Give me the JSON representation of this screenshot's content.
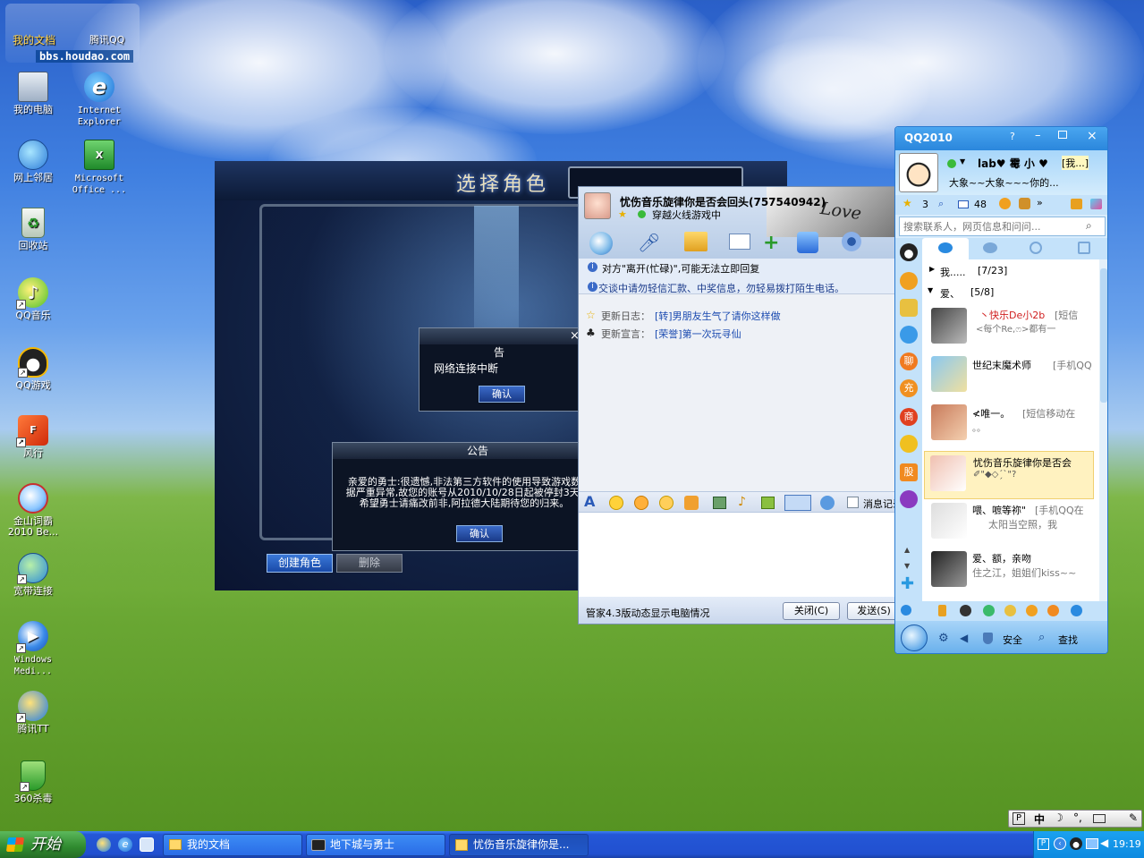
{
  "desktop": {
    "watermark": {
      "text1": "我的文档",
      "text2": "腾讯QQ",
      "url": "bbs.houdao.com"
    },
    "icons": [
      {
        "label": "我的电脑"
      },
      {
        "label": "Internet Explorer"
      },
      {
        "label": "网上邻居"
      },
      {
        "label": "Microsoft Office ..."
      },
      {
        "label": "回收站"
      },
      {
        "label": "QQ音乐"
      },
      {
        "label": "QQ游戏"
      },
      {
        "label": "风行"
      },
      {
        "label": "金山词霸 2010 Be..."
      },
      {
        "label": "宽带连接"
      },
      {
        "label": "Windows Medi..."
      },
      {
        "label": "腾讯TT"
      },
      {
        "label": "360杀毒"
      }
    ]
  },
  "game": {
    "title": "选择角色",
    "dialog1": {
      "title": "公告",
      "message": "网络连接中断",
      "ok": "确认",
      "close": "×"
    },
    "dialog2": {
      "title": "公告",
      "message": "亲爱的勇士:很遗憾,非法第三方软件的使用导致游戏数据严重异常,故您的账号从2010/10/28日起被停封3天,希望勇士请痛改前非,阿拉德大陆期待您的归来。",
      "ok": "确认"
    },
    "create_btn": "创建角色",
    "delete_btn": "删除"
  },
  "chat": {
    "title": "忧伤音乐旋律你是否会回头(757540942)",
    "status": "穿越火线游戏中",
    "banner": "Love",
    "notice1": "对方\"离开(忙碌)\",可能无法立即回复",
    "notice2": "交谈中请勿轻信汇款、中奖信息，勿轻易拨打陌生电话。",
    "log_label": "更新日志：",
    "log_text": "[转]男朋友生气了请你这样做",
    "sign_label": "更新宣言：",
    "sign_text": "[荣誉]第一次玩寻仙",
    "msg_history": "消息记录",
    "footer": "管家4.3版动态显示电脑情况",
    "close_btn": "关闭(C)",
    "send_btn": "发送(S)"
  },
  "qq": {
    "title": "QQ2010",
    "nick": "lab♥ 霉 小 ♥",
    "status_hint": "[我...]",
    "signature": "大象~~大象~~~你的...",
    "mail_count": "3",
    "msg_count": "48",
    "search_placeholder": "搜索联系人，网页信息和问问...",
    "groups": [
      {
        "name": "我.....",
        "count": "[7/23]"
      },
      {
        "name": "爱、",
        "count": "[5/8]"
      }
    ],
    "contacts": [
      {
        "name": "丶快乐De小2b",
        "extra": "[短信",
        "sig": "<每个Re,ෆ>都有一"
      },
      {
        "name": "世纪末魔术师",
        "extra": "[手机QQ",
        "sig": ""
      },
      {
        "name": "≮唯一。",
        "extra": "[短信移动在",
        "sig": "。。"
      },
      {
        "name": "忧伤音乐旋律你是否会",
        "extra": "",
        "sig": "✐\"◆◇ˊ̗ˋ\"?"
      },
      {
        "name": "喂、嗻等祢\"",
        "extra": "[手机QQ在",
        "sig": "太阳当空照，我"
      },
      {
        "name": "爱、额，亲吻",
        "extra": "",
        "sig": "住之江，姐姐们kiss~~"
      }
    ],
    "side_icons": [
      "聊",
      "充",
      "商",
      "股"
    ],
    "bottom": {
      "security": "安全",
      "find": "查找"
    }
  },
  "taskbar": {
    "start": "开始",
    "tasks": [
      "我的文档",
      "地下城与勇士",
      "忧伤音乐旋律你是..."
    ],
    "clock": "19:19",
    "ime": "中"
  },
  "colors": {
    "xp_blue": "#2150d0",
    "qq_blue": "#2e8ee6",
    "game_dark": "#0e1a33"
  }
}
